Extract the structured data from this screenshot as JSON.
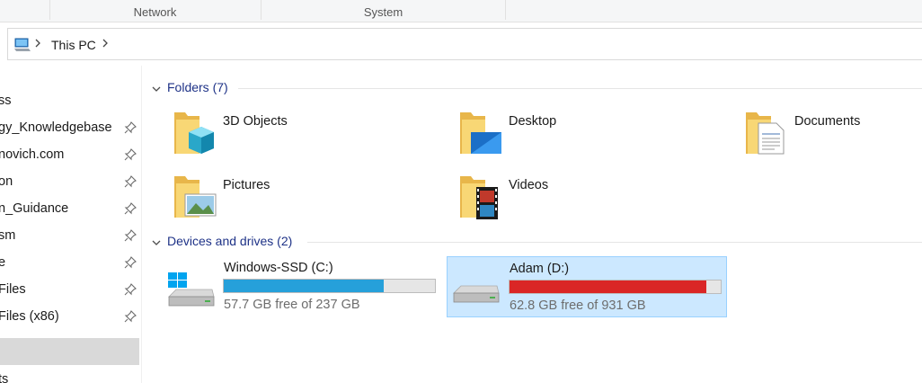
{
  "ribbon": {
    "groups": [
      "Network",
      "System"
    ]
  },
  "address": {
    "crumb": "This PC",
    "pc_icon": "computer-icon"
  },
  "nav": {
    "items": [
      {
        "label": "ss",
        "pinned": false
      },
      {
        "label": "gy_Knowledgebase",
        "pinned": true
      },
      {
        "label": "novich.com",
        "pinned": true
      },
      {
        "label": "on",
        "pinned": true
      },
      {
        "label": "n_Guidance",
        "pinned": true
      },
      {
        "label": "sm",
        "pinned": true
      },
      {
        "label": "e",
        "pinned": true
      },
      {
        "label": "Files",
        "pinned": true
      },
      {
        "label": "Files (x86)",
        "pinned": true
      },
      {
        "label": "",
        "pinned": false
      },
      {
        "label": "ts",
        "pinned": false
      }
    ],
    "selected_index": 9
  },
  "folders_section": {
    "title": "Folders (7)"
  },
  "folders": [
    {
      "name": "3D Objects",
      "icon": "3d-objects-folder-icon"
    },
    {
      "name": "Desktop",
      "icon": "desktop-folder-icon"
    },
    {
      "name": "Documents",
      "icon": "documents-folder-icon"
    },
    {
      "name": "Pictures",
      "icon": "pictures-folder-icon"
    },
    {
      "name": "Videos",
      "icon": "videos-folder-icon"
    }
  ],
  "drives_section": {
    "title": "Devices and drives (2)"
  },
  "drives": [
    {
      "name": "Windows-SSD (C:)",
      "free_text": "57.7 GB free of 237 GB",
      "used_fraction": 0.757,
      "bar_color": "#26a0da",
      "icon": "windows-drive-icon",
      "selected": false
    },
    {
      "name": "Adam (D:)",
      "free_text": "62.8 GB free of 931 GB",
      "used_fraction": 0.933,
      "bar_color": "#da2626",
      "icon": "hard-drive-icon",
      "selected": true
    }
  ],
  "colors": {
    "accent": "#1e3287",
    "selection": "#cce8ff",
    "selection_border": "#99d1ff",
    "drive_ok": "#26a0da",
    "drive_full": "#da2626"
  }
}
